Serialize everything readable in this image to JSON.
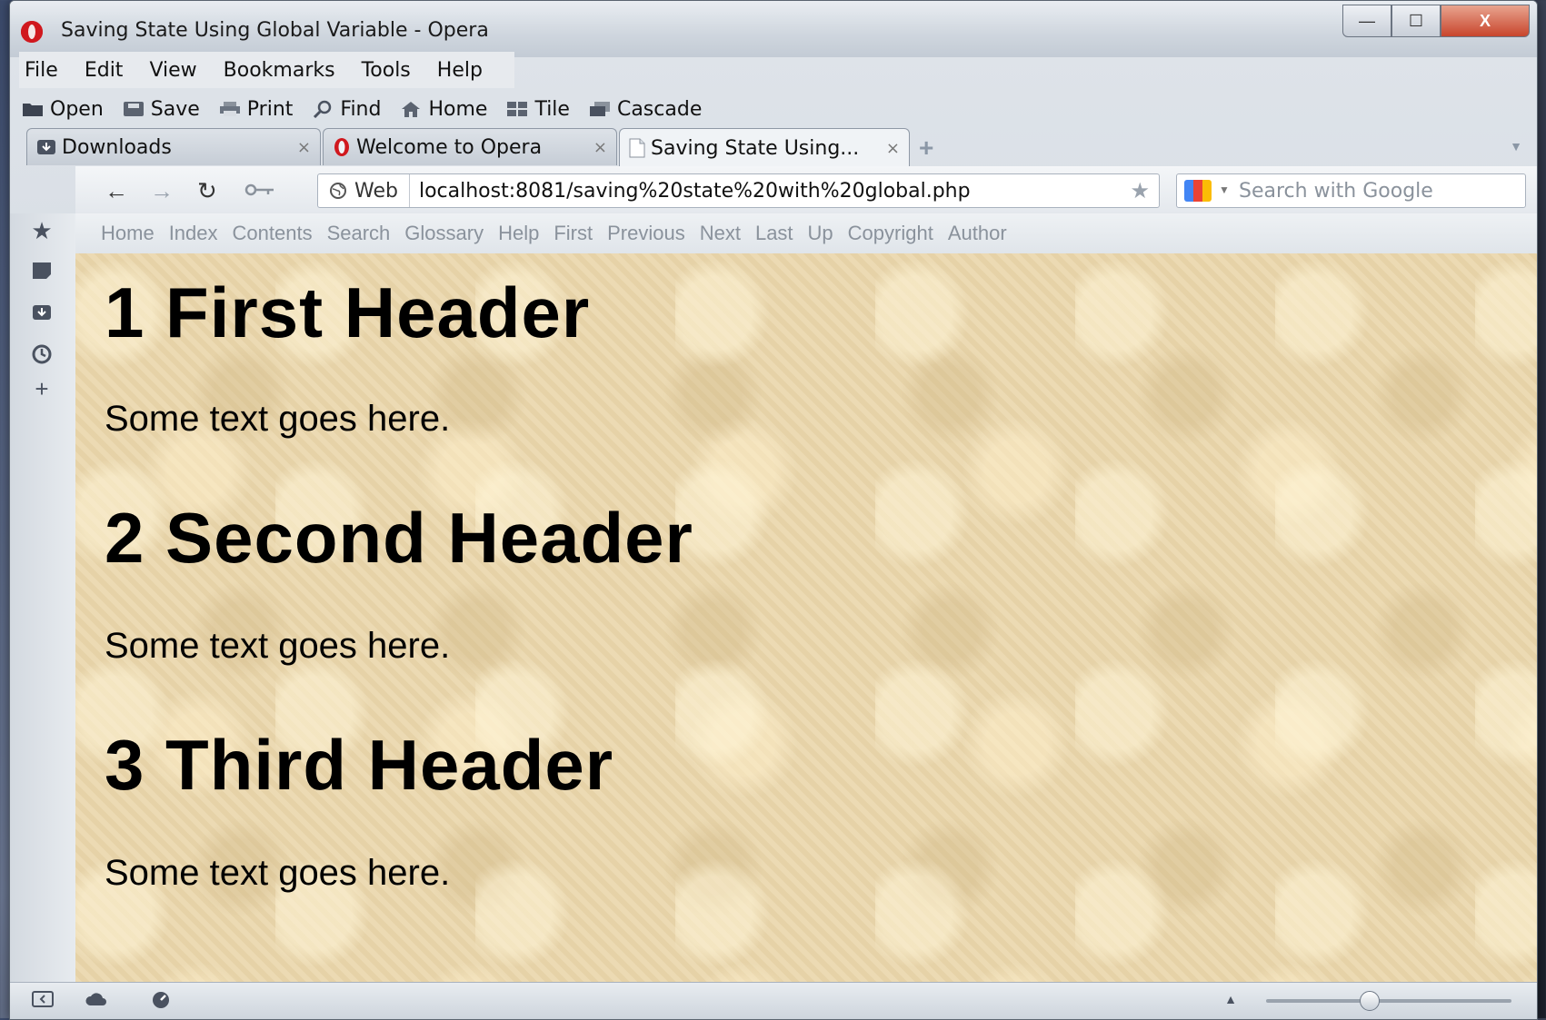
{
  "window": {
    "title": "Saving State Using Global Variable - Opera",
    "minimize_label": "—",
    "maximize_label": "☐",
    "close_label": "X"
  },
  "menu": [
    {
      "label": "File",
      "key": "F"
    },
    {
      "label": "Edit",
      "key": "E"
    },
    {
      "label": "View",
      "key": "V"
    },
    {
      "label": "Bookmarks",
      "key": "B"
    },
    {
      "label": "Tools",
      "key": "T"
    },
    {
      "label": "Help",
      "key": "H"
    }
  ],
  "toolbar": {
    "open": "Open",
    "save": "Save",
    "print": "Print",
    "find": "Find",
    "home": "Home",
    "tile": "Tile",
    "cascade": "Cascade"
  },
  "tabs": [
    {
      "label": "Downloads",
      "icon": "downloads-icon"
    },
    {
      "label": "Welcome to Opera",
      "icon": "opera-icon"
    },
    {
      "label": "Saving State Using...",
      "icon": "page-icon",
      "active": true
    }
  ],
  "address": {
    "web_label": "Web",
    "url": "localhost:8081/saving%20state%20with%20global.php",
    "search_placeholder": "Search with Google"
  },
  "nav_links": [
    "Home",
    "Index",
    "Contents",
    "Search",
    "Glossary",
    "Help",
    "First",
    "Previous",
    "Next",
    "Last",
    "Up",
    "Copyright",
    "Author"
  ],
  "content": {
    "h1": "1 First Header",
    "p1": "Some text goes here.",
    "h2": "2 Second Header",
    "p2": "Some text goes here.",
    "h3": "3 Third Header",
    "p3": "Some text goes here."
  },
  "zoom": {
    "level_fraction": 0.42
  },
  "colors": {
    "page_background": "#ead7ad",
    "close_button": "#c8452c",
    "opera_red": "#d0181e"
  }
}
